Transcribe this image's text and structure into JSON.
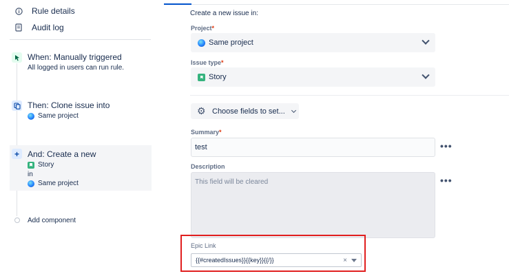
{
  "sidebar": {
    "links": [
      {
        "label": "Rule details",
        "icon": "info-icon"
      },
      {
        "label": "Audit log",
        "icon": "document-icon"
      }
    ],
    "steps": {
      "trigger": {
        "title": "When: Manually triggered",
        "subtitle": "All logged in users can run rule."
      },
      "clone": {
        "title": "Then: Clone issue into",
        "project": "Same project"
      },
      "create": {
        "title": "And: Create a new",
        "type": "Story",
        "connector": "in",
        "project": "Same project"
      }
    },
    "add_component": "Add component"
  },
  "form": {
    "heading": "Create a new issue in:",
    "project": {
      "label": "Project",
      "required": "*",
      "value": "Same project"
    },
    "issue_type": {
      "label": "Issue type",
      "required": "*",
      "value": "Story"
    },
    "choose_fields": "Choose fields to set...",
    "summary": {
      "label": "Summary",
      "required": "*",
      "value": "test"
    },
    "description": {
      "label": "Description",
      "placeholder": "This field will be cleared"
    },
    "epic_link": {
      "label": "Epic Link",
      "value": "{{#createdIssues}}{{key}}{{/}}"
    },
    "more": "•••",
    "clear": "×"
  },
  "colors": {
    "accent": "#0052cc",
    "highlight": "#e01e1e",
    "story": "#36b37e"
  }
}
